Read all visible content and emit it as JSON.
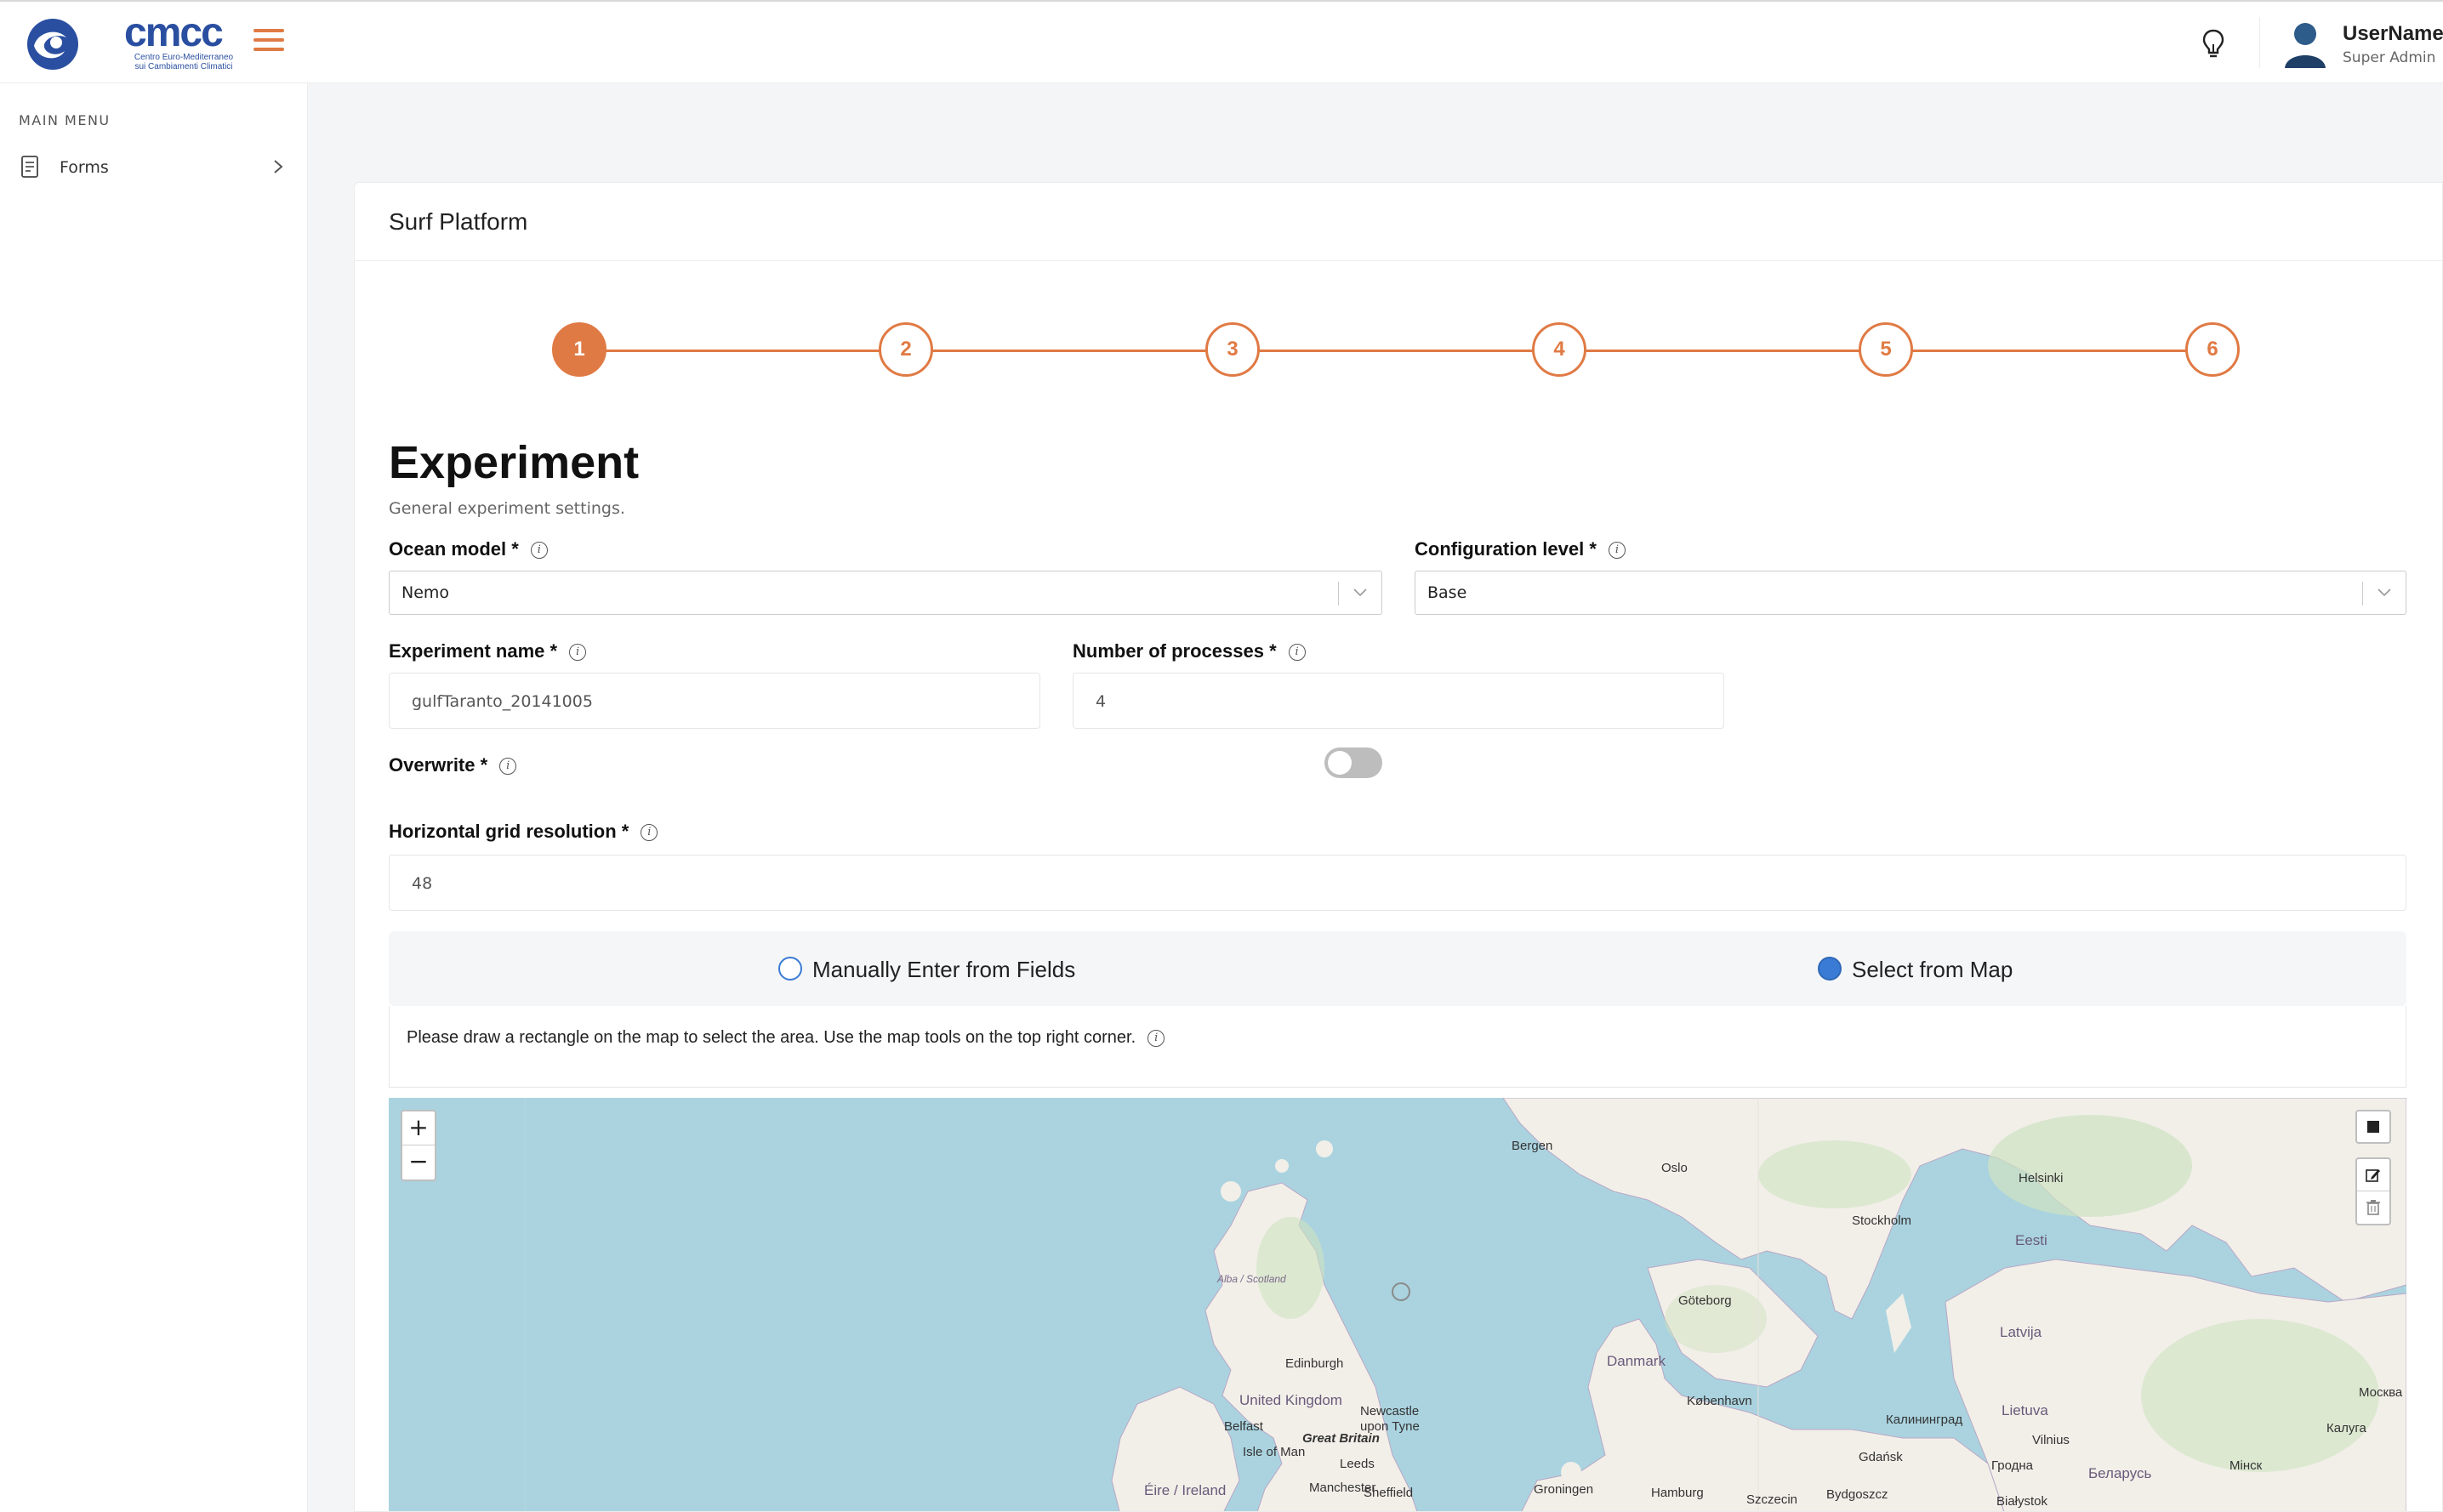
{
  "header": {
    "logo_word": "cmcc",
    "logo_sub_1": "Centro Euro-Mediterraneo",
    "logo_sub_2": "sui Cambiamenti Climatici",
    "user_name": "UserName",
    "user_role": "Super Admin"
  },
  "sidebar": {
    "title": "MAIN MENU",
    "items": [
      {
        "label": "Forms"
      }
    ]
  },
  "card": {
    "title": "Surf Platform",
    "steps": [
      "1",
      "2",
      "3",
      "4",
      "5",
      "6"
    ],
    "active_step": "1",
    "section_title": "Experiment",
    "section_sub": "General experiment settings."
  },
  "form": {
    "ocean_model_label": "Ocean model *",
    "ocean_model_value": "Nemo",
    "config_level_label": "Configuration level *",
    "config_level_value": "Base",
    "experiment_name_label": "Experiment name *",
    "experiment_name_value": "gulfTaranto_20141005",
    "num_processes_label": "Number of processes *",
    "num_processes_value": "4",
    "overwrite_label": "Overwrite *",
    "overwrite_on": false,
    "hgrid_label": "Horizontal grid resolution *",
    "hgrid_value": "48",
    "area_mode": {
      "manual_label": "Manually Enter from Fields",
      "map_label": "Select from Map",
      "selected": "map"
    },
    "map_note": "Please draw a rectangle on the map to select the area. Use the map tools on the top right corner."
  },
  "map": {
    "zoom_in": "+",
    "zoom_out": "−",
    "labels": {
      "bergen": "Bergen",
      "oslo": "Oslo",
      "stockholm": "Stockholm",
      "helsinki": "Helsinki",
      "eesti": "Eesti",
      "latvija": "Latvija",
      "lietuva": "Lietuva",
      "goteborg": "Göteborg",
      "danmark": "Danmark",
      "kobenhavn": "København",
      "edinburgh": "Edinburgh",
      "united_kingdom": "United Kingdom",
      "great_britain": "Great Britain",
      "newcastle": "Newcastle upon Tyne",
      "belfast": "Belfast",
      "isle_of_man": "Isle of Man",
      "leeds": "Leeds",
      "manchester": "Manchester",
      "sheffield": "Sheffield",
      "eire": "Éire / Ireland",
      "groningen": "Groningen",
      "hamburg": "Hamburg",
      "szczecin": "Szczecin",
      "gdansk": "Gdańsk",
      "bydgoszcz": "Bydgoszcz",
      "kaliningrad": "Калининград",
      "vilnius": "Vilnius",
      "grodno": "Гродна",
      "belarus": "Беларусь",
      "bialystok": "Białystok",
      "minsk": "Мінск",
      "moskva": "Москва",
      "kaluga": "Калуга",
      "alba": "Alba / Scotland"
    }
  },
  "colors": {
    "accent": "#e07a44",
    "brand": "#2a4fa1",
    "radio": "#3a7bd5",
    "sea": "#aad3df",
    "land": "#f2efe9"
  }
}
